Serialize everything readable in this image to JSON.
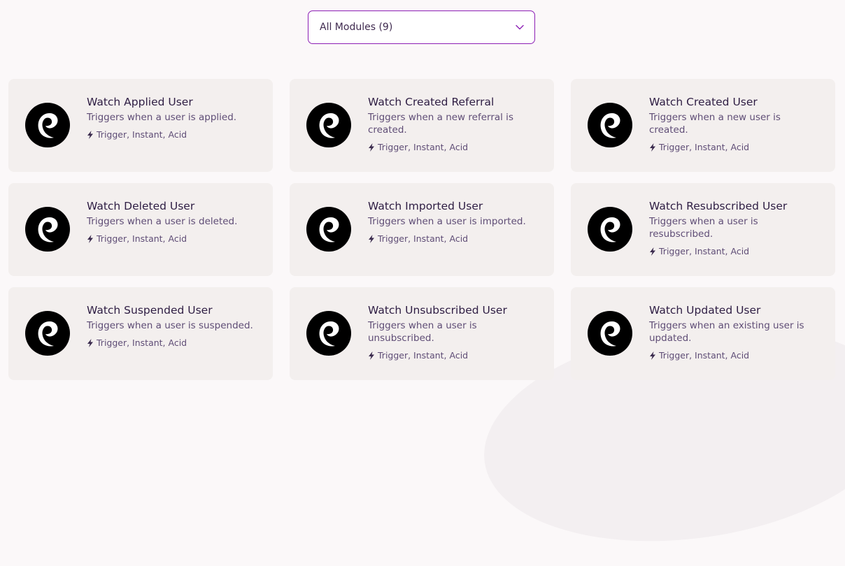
{
  "filter": {
    "selected": "All Modules (9)",
    "icon": "chevron-down-icon"
  },
  "brand": {
    "accent": "#8c1fb5",
    "card_bg": "#f3efee",
    "title_color": "#2e1d43"
  },
  "modules": [
    {
      "title": "Watch Applied User",
      "description": "Triggers when a user is applied.",
      "tags": "Trigger, Instant, Acid"
    },
    {
      "title": "Watch Created Referral",
      "description": "Triggers when a new referral is created.",
      "tags": "Trigger, Instant, Acid"
    },
    {
      "title": "Watch Created User",
      "description": "Triggers when a new user is created.",
      "tags": "Trigger, Instant, Acid"
    },
    {
      "title": "Watch Deleted User",
      "description": "Triggers when a user is deleted.",
      "tags": "Trigger, Instant, Acid"
    },
    {
      "title": "Watch Imported User",
      "description": "Triggers when a user is imported.",
      "tags": "Trigger, Instant, Acid"
    },
    {
      "title": "Watch Resubscribed User",
      "description": "Triggers when a user is resubscribed.",
      "tags": "Trigger, Instant, Acid"
    },
    {
      "title": "Watch Suspended User",
      "description": "Triggers when a user is suspended.",
      "tags": "Trigger, Instant, Acid"
    },
    {
      "title": "Watch Unsubscribed User",
      "description": "Triggers when a user is unsubscribed.",
      "tags": "Trigger, Instant, Acid"
    },
    {
      "title": "Watch Updated User",
      "description": "Triggers when an existing user is updated.",
      "tags": "Trigger, Instant, Acid"
    }
  ]
}
